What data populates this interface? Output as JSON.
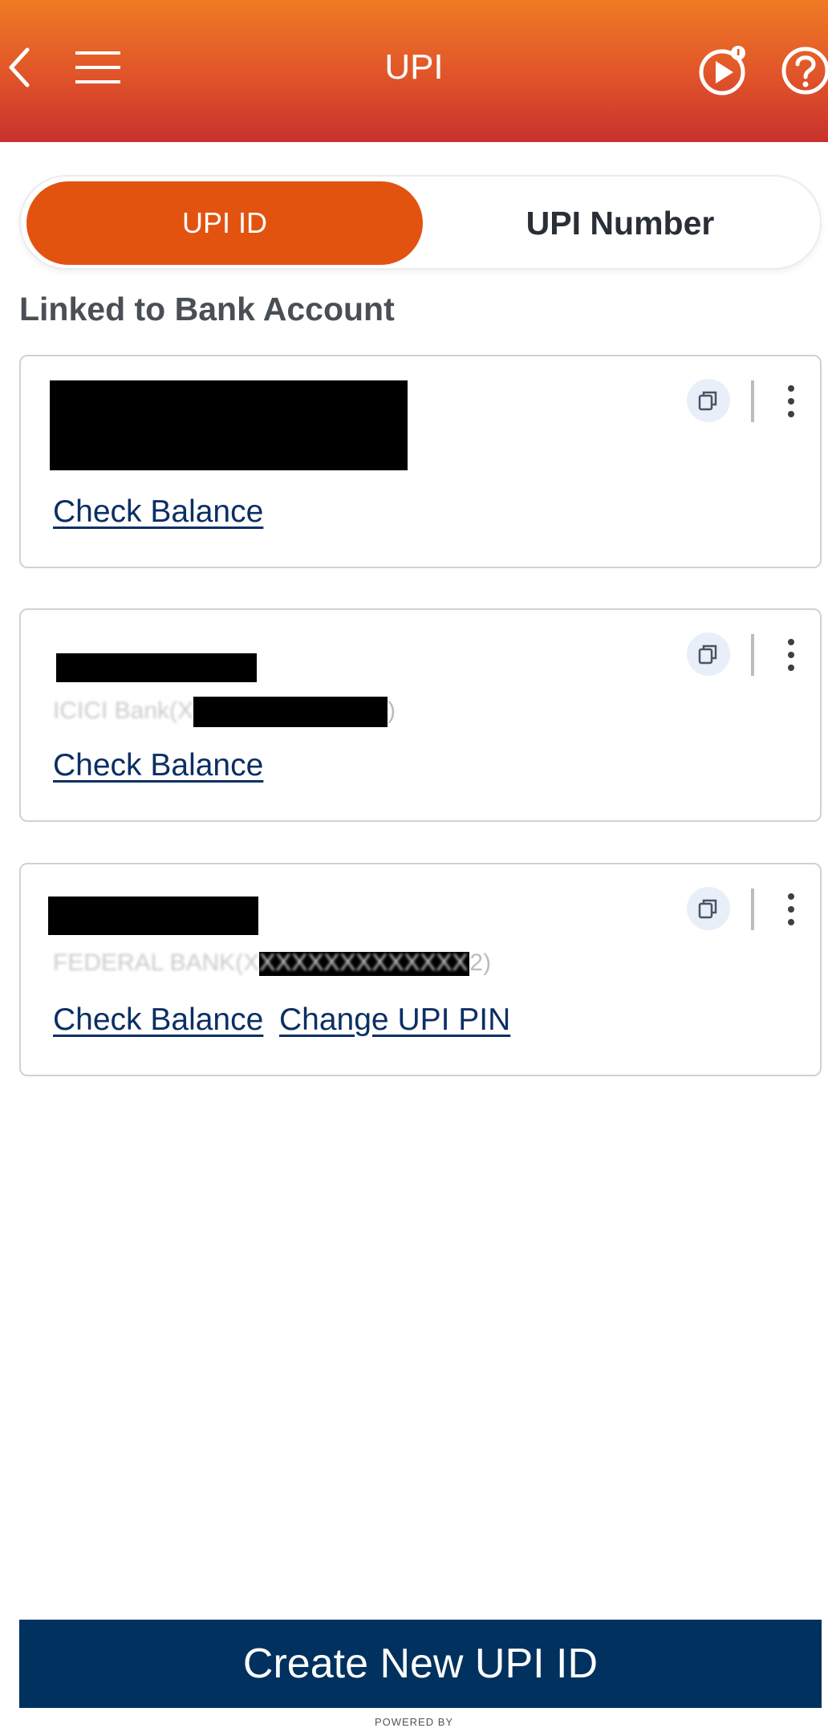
{
  "header": {
    "title": "UPI",
    "icons": [
      "back-arrow-icon",
      "hamburger-menu-icon",
      "video-tutorial-icon",
      "help-question-icon"
    ]
  },
  "tabs": [
    {
      "label": "UPI ID",
      "active": true
    },
    {
      "label": "UPI Number",
      "active": false
    }
  ],
  "section_title": "Linked to Bank Account",
  "cards": [
    {
      "check_balance": "Check Balance"
    },
    {
      "account_visible_prefix": "ICICI Bank(X",
      "account_visible_suffix": ")",
      "check_balance": "Check Balance"
    },
    {
      "account_visible_prefix": "FEDERAL BANK(XXXXXXXXXXXXXX",
      "account_visible_suffix": "2)",
      "check_balance": "Check Balance",
      "change_pin": "Change UPI PIN"
    }
  ],
  "create_button": "Create New UPI ID",
  "footer": {
    "powered_by": "POWERED BY"
  },
  "colors": {
    "header_top": "#ee7b24",
    "header_bottom": "#c8312d",
    "active_tab": "#e35310",
    "link": "#0b2f64",
    "primary_button": "#00315f"
  }
}
